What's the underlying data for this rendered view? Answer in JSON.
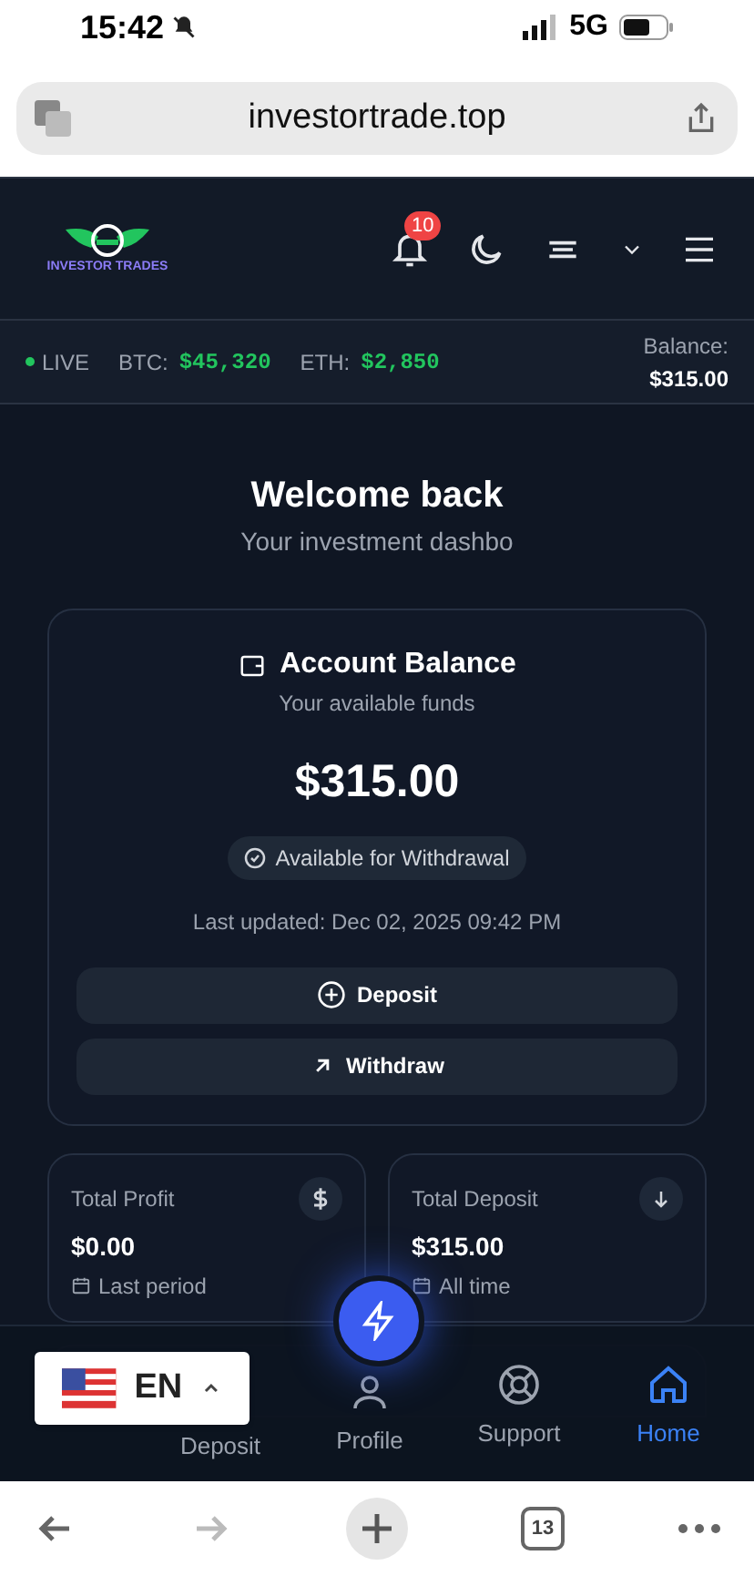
{
  "status_bar": {
    "time": "15:42",
    "network": "5G"
  },
  "browser": {
    "url": "investortrade.top",
    "tab_count": "13"
  },
  "header": {
    "logo_text": "INVESTOR TRADES",
    "notification_count": "10"
  },
  "ticker": {
    "live": "LIVE",
    "btc_label": "BTC:",
    "btc_value": "$45,320",
    "eth_label": "ETH:",
    "eth_value": "$2,850",
    "balance_label": "Balance:",
    "balance_value": "$315.00"
  },
  "welcome": {
    "title": "Welcome back",
    "subtitle": "Your investment dashbo"
  },
  "balance_card": {
    "title": "Account Balance",
    "subtitle": "Your available funds",
    "amount": "$315.00",
    "badge": "Available for Withdrawal",
    "updated": "Last updated: Dec 02, 2025 09:42 PM",
    "buttons": [
      {
        "kind": "deposit",
        "label": "Deposit"
      },
      {
        "kind": "withdraw",
        "label": "Withdraw"
      }
    ]
  },
  "stats": [
    {
      "kind": "profit",
      "title": "Total Profit",
      "value": "$0.00",
      "period": "Last period"
    },
    {
      "kind": "deposit",
      "title": "Total Deposit",
      "value": "$315.00",
      "period": "All time"
    }
  ],
  "bottom_nav": [
    {
      "kind": "deposit",
      "label": "Deposit",
      "selected": false
    },
    {
      "kind": "profile",
      "label": "Profile",
      "selected": false
    },
    {
      "kind": "support",
      "label": "Support",
      "selected": false
    },
    {
      "kind": "home",
      "label": "Home",
      "selected": true
    }
  ],
  "language": {
    "code": "EN"
  }
}
